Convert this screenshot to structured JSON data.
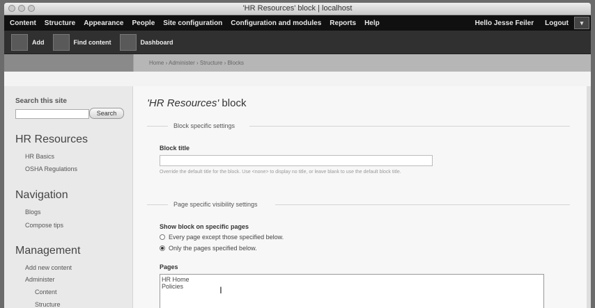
{
  "window": {
    "title": "'HR Resources' block | localhost"
  },
  "admin_menu": {
    "items": [
      "Content",
      "Structure",
      "Appearance",
      "People",
      "Site configuration",
      "Configuration and modules",
      "Reports",
      "Help"
    ],
    "greeting": "Hello Jesse Feiler",
    "logout": "Logout"
  },
  "shortcuts": [
    "Add",
    "Find content",
    "Dashboard"
  ],
  "breadcrumb": "Home › Administer › Structure › Blocks",
  "sidebar": {
    "search_label": "Search this site",
    "search_button": "Search",
    "blocks": [
      {
        "title": "HR Resources",
        "items": [
          "HR Basics",
          "OSHA Regulations"
        ]
      },
      {
        "title": "Navigation",
        "items": [
          "Blogs",
          "Compose tips"
        ]
      },
      {
        "title": "Management",
        "items": [
          "Add new content",
          "Administer",
          "Content",
          "Structure"
        ]
      }
    ]
  },
  "main": {
    "page_title_em": "'HR Resources'",
    "page_title_rest": " block",
    "fieldset1": "Block specific settings",
    "block_title_label": "Block title",
    "block_title_desc": "Override the default title for the block. Use <none> to display no title, or leave blank to use the default block title.",
    "fieldset2": "Page specific visibility settings",
    "show_block_label": "Show block on specific pages",
    "radio_options": [
      "Every page except those specified below.",
      "Only the pages specified below."
    ],
    "radio_selected": 1,
    "pages_label": "Pages",
    "pages_value": "HR Home\nPolicies"
  }
}
